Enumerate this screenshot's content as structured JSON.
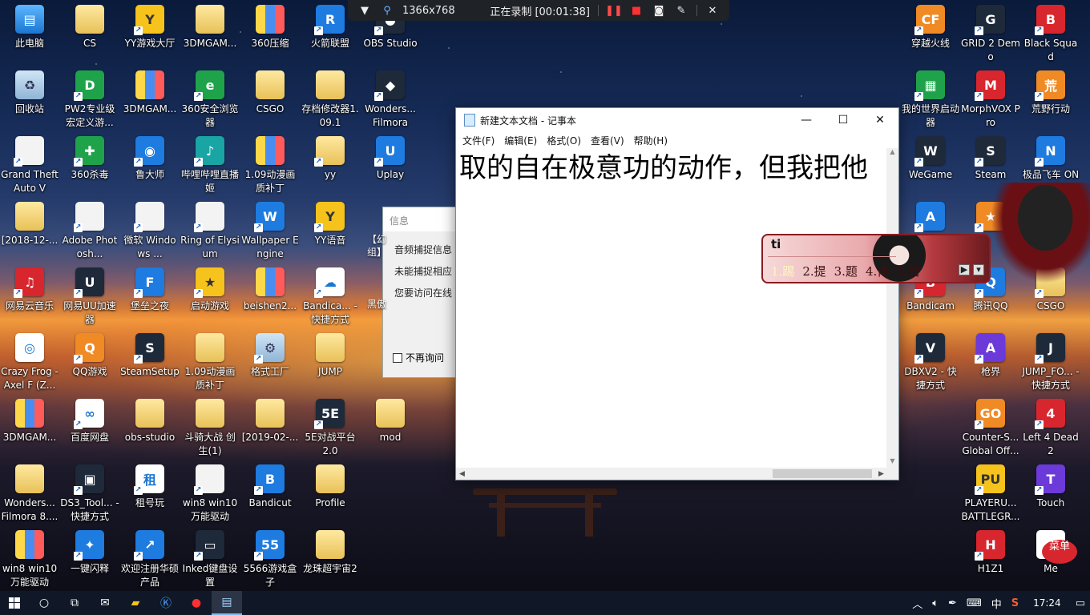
{
  "recorder": {
    "resolution": "1366x768",
    "status": "正在录制 [00:01:38]"
  },
  "desktop_icons": [
    {
      "label": "此电脑",
      "glyph": "▤",
      "style": "g-pc",
      "shortcut": false
    },
    {
      "label": "CS",
      "glyph": "",
      "style": "g-folder",
      "shortcut": false
    },
    {
      "label": "YY游戏大厅",
      "glyph": "Y",
      "style": "g-yellow",
      "shortcut": true
    },
    {
      "label": "3DMGAM...",
      "glyph": "",
      "style": "g-folder",
      "shortcut": false
    },
    {
      "label": "360压缩",
      "glyph": "",
      "style": "g-zip",
      "shortcut": false
    },
    {
      "label": "火箭联盟",
      "glyph": "R",
      "style": "g-blue",
      "shortcut": true
    },
    {
      "label": "OBS Studio",
      "glyph": "●",
      "style": "g-dark",
      "shortcut": true
    },
    {
      "label": "回收站",
      "glyph": "♻",
      "style": "g-bin",
      "shortcut": false
    },
    {
      "label": "PW2专业级宏定义游...",
      "glyph": "D",
      "style": "g-green",
      "shortcut": true
    },
    {
      "label": "3DMGAM...",
      "glyph": "",
      "style": "g-zip",
      "shortcut": false
    },
    {
      "label": "360安全浏览器",
      "glyph": "e",
      "style": "g-green",
      "shortcut": true
    },
    {
      "label": "CSGO",
      "glyph": "",
      "style": "g-folder",
      "shortcut": false
    },
    {
      "label": "存档修改器1.09.1",
      "glyph": "",
      "style": "g-folder",
      "shortcut": false
    },
    {
      "label": "Wonders... Filmora",
      "glyph": "◆",
      "style": "g-dark",
      "shortcut": true
    },
    {
      "label": "Grand Theft Auto V",
      "glyph": "",
      "style": "g-file",
      "shortcut": true
    },
    {
      "label": "360杀毒",
      "glyph": "✚",
      "style": "g-green",
      "shortcut": true
    },
    {
      "label": "鲁大师",
      "glyph": "◉",
      "style": "g-blue",
      "shortcut": true
    },
    {
      "label": "哔哩哔哩直播姬",
      "glyph": "♪",
      "style": "g-teal",
      "shortcut": true
    },
    {
      "label": "1.09动漫画质补丁",
      "glyph": "",
      "style": "g-zip",
      "shortcut": false
    },
    {
      "label": "yy",
      "glyph": "",
      "style": "g-folder",
      "shortcut": true
    },
    {
      "label": "Uplay",
      "glyph": "U",
      "style": "g-blue",
      "shortcut": true
    },
    {
      "label": "[2018-12-...",
      "glyph": "",
      "style": "g-folder",
      "shortcut": false
    },
    {
      "label": "Adobe Photosh...",
      "glyph": "",
      "style": "g-file",
      "shortcut": true
    },
    {
      "label": "微软 Windows ...",
      "glyph": "",
      "style": "g-file",
      "shortcut": true
    },
    {
      "label": "Ring of Elysium",
      "glyph": "",
      "style": "g-file",
      "shortcut": true
    },
    {
      "label": "Wallpaper Engine",
      "glyph": "W",
      "style": "g-blue",
      "shortcut": true
    },
    {
      "label": "YY语音",
      "glyph": "Y",
      "style": "g-yellow",
      "shortcut": true
    },
    {
      "label": "网易云音乐",
      "glyph": "♫",
      "style": "g-red",
      "shortcut": true
    },
    {
      "label": "网易UU加速器",
      "glyph": "U",
      "style": "g-dark",
      "shortcut": true
    },
    {
      "label": "堡垒之夜",
      "glyph": "F",
      "style": "g-blue",
      "shortcut": true
    },
    {
      "label": "启动游戏",
      "glyph": "★",
      "style": "g-yellow",
      "shortcut": true
    },
    {
      "label": "beishen2...",
      "glyph": "",
      "style": "g-zip",
      "shortcut": false
    },
    {
      "label": "Bandica... - 快捷方式",
      "glyph": "☁",
      "style": "g-white",
      "shortcut": true
    },
    {
      "label": "Crazy Frog - Axel F (Z...",
      "glyph": "◎",
      "style": "g-white",
      "shortcut": false
    },
    {
      "label": "QQ游戏",
      "glyph": "Q",
      "style": "g-orange",
      "shortcut": true
    },
    {
      "label": "SteamSetup",
      "glyph": "S",
      "style": "g-dark",
      "shortcut": true
    },
    {
      "label": "1.09动漫画质补丁",
      "glyph": "",
      "style": "g-folder",
      "shortcut": false
    },
    {
      "label": "格式工厂",
      "glyph": "⚙",
      "style": "g-bin",
      "shortcut": true
    },
    {
      "label": "JUMP",
      "glyph": "",
      "style": "g-folder",
      "shortcut": false
    },
    {
      "label": "3DMGAM...",
      "glyph": "",
      "style": "g-zip",
      "shortcut": false
    },
    {
      "label": "百度网盘",
      "glyph": "∞",
      "style": "g-white",
      "shortcut": true
    },
    {
      "label": "obs-studio",
      "glyph": "",
      "style": "g-folder",
      "shortcut": false
    },
    {
      "label": "斗骑大战 创生(1)",
      "glyph": "",
      "style": "g-folder",
      "shortcut": false
    },
    {
      "label": "[2019-02-...",
      "glyph": "",
      "style": "g-folder",
      "shortcut": false
    },
    {
      "label": "5E对战平台2.0",
      "glyph": "5E",
      "style": "g-dark",
      "shortcut": true
    },
    {
      "label": "mod",
      "glyph": "",
      "style": "g-folder",
      "shortcut": false
    },
    {
      "label": "Wonders... Filmora 8....",
      "glyph": "",
      "style": "g-folder",
      "shortcut": false
    },
    {
      "label": "DS3_Tool... - 快捷方式",
      "glyph": "▣",
      "style": "g-dark",
      "shortcut": true
    },
    {
      "label": "租号玩",
      "glyph": "租",
      "style": "g-white",
      "shortcut": true
    },
    {
      "label": "win8 win10 万能驱动",
      "glyph": "",
      "style": "g-file",
      "shortcut": true
    },
    {
      "label": "Bandicut",
      "glyph": "B",
      "style": "g-blue",
      "shortcut": true
    },
    {
      "label": "Profile",
      "glyph": "",
      "style": "g-folder",
      "shortcut": false
    },
    {
      "label": "win8 win10 万能驱动",
      "glyph": "",
      "style": "g-zip",
      "shortcut": false
    },
    {
      "label": "一键闪释",
      "glyph": "✦",
      "style": "g-blue",
      "shortcut": true
    },
    {
      "label": "欢迎注册华硕产品",
      "glyph": "↗",
      "style": "g-blue",
      "shortcut": true
    },
    {
      "label": "Inked键盘设置",
      "glyph": "▭",
      "style": "g-dark",
      "shortcut": true
    },
    {
      "label": "5566游戏盒子",
      "glyph": "55",
      "style": "g-blue",
      "shortcut": true
    },
    {
      "label": "龙珠超宇宙2",
      "glyph": "",
      "style": "g-folder",
      "shortcut": false
    },
    {
      "label": "穿越火线",
      "glyph": "CF",
      "style": "g-orange",
      "shortcut": true
    },
    {
      "label": "GRID 2 Demo",
      "glyph": "G",
      "style": "g-dark",
      "shortcut": true
    },
    {
      "label": "Black Squad",
      "glyph": "B",
      "style": "g-red",
      "shortcut": true
    },
    {
      "label": "我的世界启动器",
      "glyph": "▦",
      "style": "g-green",
      "shortcut": true
    },
    {
      "label": "MorphVOX Pro",
      "glyph": "M",
      "style": "g-red",
      "shortcut": true
    },
    {
      "label": "荒野行动",
      "glyph": "荒",
      "style": "g-orange",
      "shortcut": true
    },
    {
      "label": "WeGame",
      "glyph": "W",
      "style": "g-dark",
      "shortcut": true
    },
    {
      "label": "Steam",
      "glyph": "S",
      "style": "g-dark",
      "shortcut": true
    },
    {
      "label": "极品飞车 ONLINE",
      "glyph": "N",
      "style": "g-blue",
      "shortcut": true
    },
    {
      "label": "",
      "glyph": "A",
      "style": "g-blue",
      "shortcut": true
    },
    {
      "label": "",
      "glyph": "★",
      "style": "g-orange",
      "shortcut": true
    },
    {
      "label": "Bandicam",
      "glyph": "B",
      "style": "g-red",
      "shortcut": true
    },
    {
      "label": "腾讯QQ",
      "glyph": "Q",
      "style": "g-blue",
      "shortcut": true
    },
    {
      "label": "CSGO",
      "glyph": "",
      "style": "g-folder",
      "shortcut": true
    },
    {
      "label": "DBXV2 - 快捷方式",
      "glyph": "V",
      "style": "g-dark",
      "shortcut": true
    },
    {
      "label": "枪界",
      "glyph": "A",
      "style": "g-purple",
      "shortcut": true
    },
    {
      "label": "JUMP_FO... - 快捷方式",
      "glyph": "J",
      "style": "g-dark",
      "shortcut": true
    },
    {
      "label": "Counter-S... Global Off...",
      "glyph": "GO",
      "style": "g-orange",
      "shortcut": true
    },
    {
      "label": "Left 4 Dead 2",
      "glyph": "4",
      "style": "g-red",
      "shortcut": true
    },
    {
      "label": "PLAYERU... BATTLEGR...",
      "glyph": "PU",
      "style": "g-yellow",
      "shortcut": true
    },
    {
      "label": "Touch",
      "glyph": "T",
      "style": "g-purple",
      "shortcut": true
    },
    {
      "label": "H1Z1",
      "glyph": "H",
      "style": "g-red",
      "shortcut": true
    },
    {
      "label": "Me",
      "glyph": "",
      "style": "g-white",
      "shortcut": false
    }
  ],
  "info_dialog": {
    "title": "信息",
    "line1": "音频捕捉信息",
    "line2": "未能捕捉相应",
    "line3": "您要访问在线",
    "checkbox": "不再询问",
    "side_label1": "【幻",
    "side_label2": "组】",
    "side_label3": "黑傲"
  },
  "notepad": {
    "title": "新建文本文档 - 记事本",
    "menu": [
      "文件(F)",
      "编辑(E)",
      "格式(O)",
      "查看(V)",
      "帮助(H)"
    ],
    "text": "取的自在极意功的动作，但我把他"
  },
  "ime": {
    "typed": "ti",
    "candidates": [
      "1.踢",
      "2.提",
      "3.题",
      "4.体",
      "5.替"
    ]
  },
  "taskbar": {
    "clock": "17:24",
    "lang": "中"
  },
  "menu_bubble": "菜单"
}
